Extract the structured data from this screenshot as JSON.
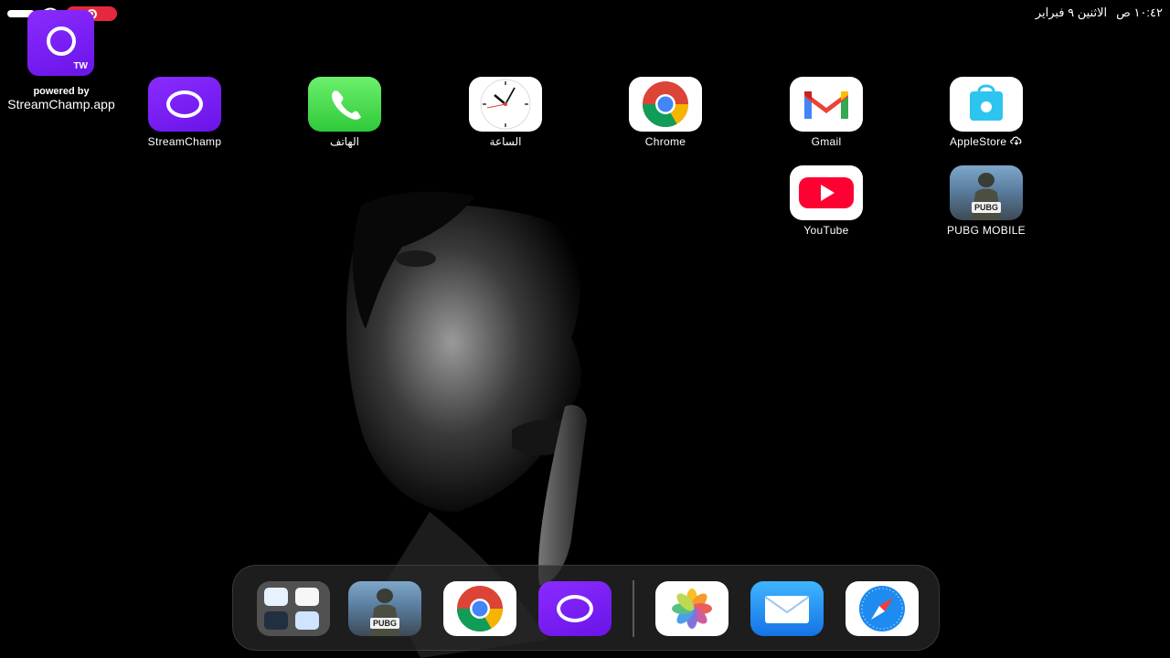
{
  "status_bar": {
    "time": "١٠:٤٢ ص",
    "date": "الاثنين ٩ فبراير"
  },
  "overlay": {
    "badge_text": "TW",
    "powered_by": "powered by",
    "domain": "StreamChamp.app"
  },
  "apps": [
    {
      "label": "StreamChamp",
      "icon": "streamchamp-icon"
    },
    {
      "label": "الهاتف",
      "icon": "phone-icon"
    },
    {
      "label": "الساعة",
      "icon": "clock-icon"
    },
    {
      "label": "Chrome",
      "icon": "chrome-icon"
    },
    {
      "label": "Gmail",
      "icon": "gmail-icon"
    },
    {
      "label": "AppleStore",
      "icon": "appstore-icon"
    },
    {
      "label": "YouTube",
      "icon": "youtube-icon"
    },
    {
      "label": "PUBG MOBILE",
      "icon": "pubg-icon"
    }
  ],
  "dock": [
    {
      "icon": "app-folder-icon"
    },
    {
      "icon": "pubg-icon"
    },
    {
      "icon": "chrome-icon"
    },
    {
      "icon": "streamchamp-icon"
    },
    {
      "icon": "photos-icon"
    },
    {
      "icon": "mail-icon"
    },
    {
      "icon": "safari-icon"
    }
  ],
  "colors": {
    "recording": "#e5283e",
    "streamchamp": "#7a1ff5",
    "phone": "#34c759"
  },
  "pubg_icon_text": "PUBG"
}
